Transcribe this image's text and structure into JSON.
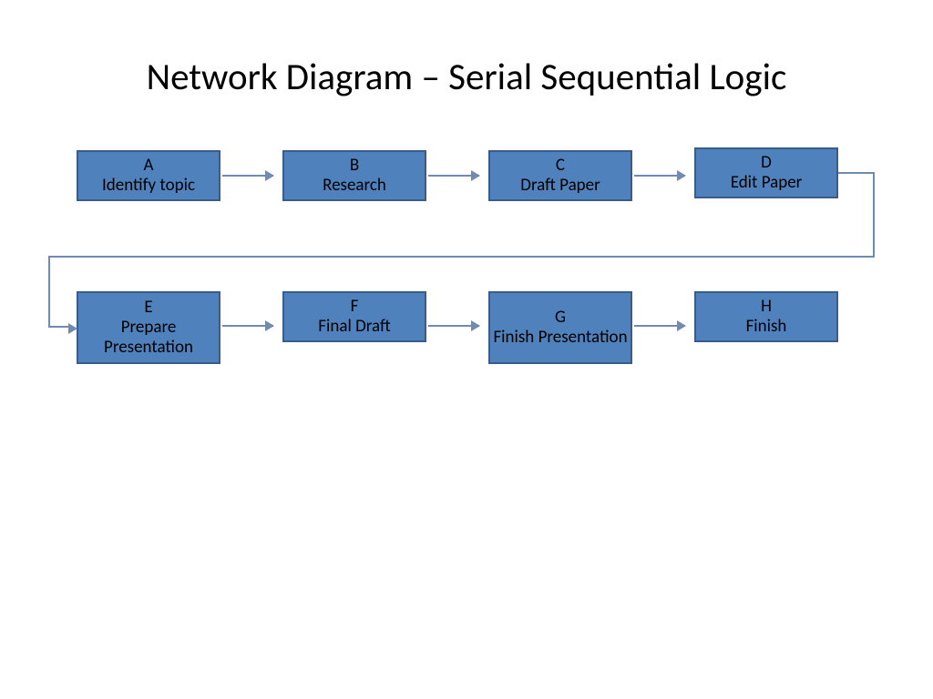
{
  "title": "Network Diagram – Serial Sequential Logic",
  "nodes": {
    "a": {
      "letter": "A",
      "label": "Identify topic"
    },
    "b": {
      "letter": "B",
      "label": "Research"
    },
    "c": {
      "letter": "C",
      "label": "Draft Paper"
    },
    "d": {
      "letter": "D",
      "label": "Edit Paper"
    },
    "e": {
      "letter": "E",
      "label": "Prepare Presentation"
    },
    "f": {
      "letter": "F",
      "label": "Final Draft"
    },
    "g": {
      "letter": "G",
      "label": "Finish Presentation"
    },
    "h": {
      "letter": "H",
      "label": "Finish"
    }
  },
  "edges": [
    [
      "a",
      "b"
    ],
    [
      "b",
      "c"
    ],
    [
      "c",
      "d"
    ],
    [
      "d",
      "e"
    ],
    [
      "e",
      "f"
    ],
    [
      "f",
      "g"
    ],
    [
      "g",
      "h"
    ]
  ]
}
